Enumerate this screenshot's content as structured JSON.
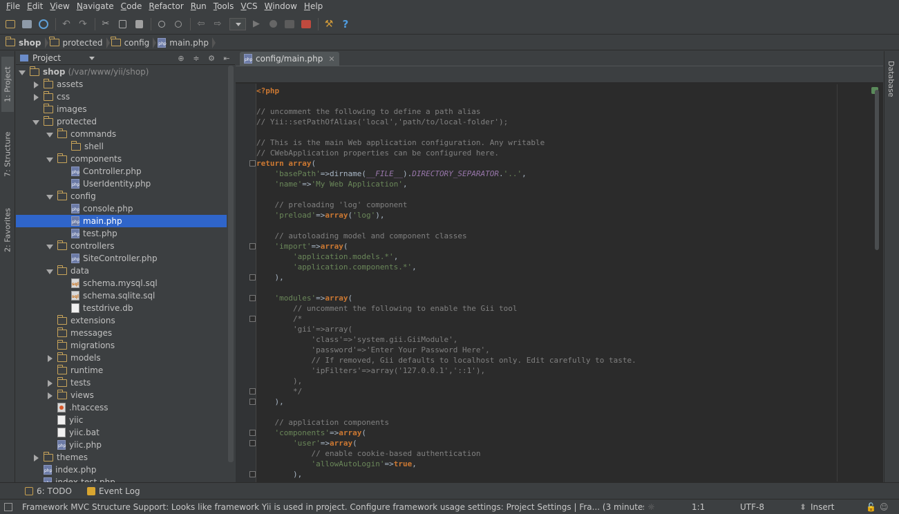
{
  "menu": [
    {
      "label": "File",
      "u": "F",
      "rest": "ile"
    },
    {
      "label": "Edit",
      "u": "E",
      "rest": "dit"
    },
    {
      "label": "View",
      "u": "V",
      "rest": "iew"
    },
    {
      "label": "Navigate",
      "u": "N",
      "rest": "avigate"
    },
    {
      "label": "Code",
      "u": "C",
      "rest": "ode"
    },
    {
      "label": "Refactor",
      "u": "R",
      "rest": "efactor"
    },
    {
      "label": "Run",
      "u": "R",
      "rest": "un"
    },
    {
      "label": "Tools",
      "u": "T",
      "rest": "ools"
    },
    {
      "label": "VCS",
      "u": "V",
      "rest": "CS"
    },
    {
      "label": "Window",
      "u": "W",
      "rest": "indow"
    },
    {
      "label": "Help",
      "u": "H",
      "rest": "elp"
    }
  ],
  "breadcrumb": [
    "shop",
    "protected",
    "config",
    "main.php"
  ],
  "project_panel": {
    "title": "Project",
    "tree": [
      {
        "depth": 0,
        "arrow": "open",
        "icon": "folder",
        "label": "shop",
        "extra": "(/var/www/yii/shop)",
        "bold": true
      },
      {
        "depth": 1,
        "arrow": "closed",
        "icon": "folder",
        "label": "assets"
      },
      {
        "depth": 1,
        "arrow": "closed",
        "icon": "folder",
        "label": "css"
      },
      {
        "depth": 1,
        "arrow": "none",
        "icon": "folder",
        "label": "images"
      },
      {
        "depth": 1,
        "arrow": "open",
        "icon": "folder",
        "label": "protected"
      },
      {
        "depth": 2,
        "arrow": "open",
        "icon": "folder",
        "label": "commands"
      },
      {
        "depth": 3,
        "arrow": "none",
        "icon": "folder",
        "label": "shell"
      },
      {
        "depth": 2,
        "arrow": "open",
        "icon": "folder",
        "label": "components"
      },
      {
        "depth": 3,
        "arrow": "none",
        "icon": "php",
        "label": "Controller.php"
      },
      {
        "depth": 3,
        "arrow": "none",
        "icon": "php",
        "label": "UserIdentity.php"
      },
      {
        "depth": 2,
        "arrow": "open",
        "icon": "folder",
        "label": "config"
      },
      {
        "depth": 3,
        "arrow": "none",
        "icon": "php",
        "label": "console.php"
      },
      {
        "depth": 3,
        "arrow": "none",
        "icon": "php",
        "label": "main.php",
        "selected": true
      },
      {
        "depth": 3,
        "arrow": "none",
        "icon": "php",
        "label": "test.php"
      },
      {
        "depth": 2,
        "arrow": "open",
        "icon": "folder",
        "label": "controllers"
      },
      {
        "depth": 3,
        "arrow": "none",
        "icon": "php",
        "label": "SiteController.php"
      },
      {
        "depth": 2,
        "arrow": "open",
        "icon": "folder",
        "label": "data"
      },
      {
        "depth": 3,
        "arrow": "none",
        "icon": "sql",
        "label": "schema.mysql.sql"
      },
      {
        "depth": 3,
        "arrow": "none",
        "icon": "sql",
        "label": "schema.sqlite.sql"
      },
      {
        "depth": 3,
        "arrow": "none",
        "icon": "txt",
        "label": "testdrive.db"
      },
      {
        "depth": 2,
        "arrow": "none",
        "icon": "folder",
        "label": "extensions"
      },
      {
        "depth": 2,
        "arrow": "none",
        "icon": "folder",
        "label": "messages"
      },
      {
        "depth": 2,
        "arrow": "none",
        "icon": "folder",
        "label": "migrations"
      },
      {
        "depth": 2,
        "arrow": "closed",
        "icon": "folder",
        "label": "models"
      },
      {
        "depth": 2,
        "arrow": "none",
        "icon": "folder",
        "label": "runtime"
      },
      {
        "depth": 2,
        "arrow": "closed",
        "icon": "folder",
        "label": "tests"
      },
      {
        "depth": 2,
        "arrow": "closed",
        "icon": "folder",
        "label": "views"
      },
      {
        "depth": 2,
        "arrow": "none",
        "icon": "ht",
        "label": ".htaccess"
      },
      {
        "depth": 2,
        "arrow": "none",
        "icon": "txt",
        "label": "yiic"
      },
      {
        "depth": 2,
        "arrow": "none",
        "icon": "txt",
        "label": "yiic.bat"
      },
      {
        "depth": 2,
        "arrow": "none",
        "icon": "php",
        "label": "yiic.php"
      },
      {
        "depth": 1,
        "arrow": "closed",
        "icon": "folder",
        "label": "themes"
      },
      {
        "depth": 1,
        "arrow": "none",
        "icon": "php",
        "label": "index.php"
      },
      {
        "depth": 1,
        "arrow": "none",
        "icon": "php",
        "label": "index-test.php"
      }
    ]
  },
  "left_tabs": {
    "project": "1: Project",
    "structure": "7: Structure",
    "favorites": "2: Favorites"
  },
  "right_tabs": {
    "database": "Database"
  },
  "editor": {
    "tab_label": "config/main.php",
    "tab_close": "✕",
    "lines": [
      {
        "i": 0,
        "s": [
          [
            "php",
            "<?php"
          ]
        ]
      },
      {
        "i": 2,
        "s": [
          [
            "com",
            "// uncomment the following to define a path alias"
          ]
        ]
      },
      {
        "i": 3,
        "s": [
          [
            "com",
            "// Yii::setPathOfAlias('local','path/to/local-folder');"
          ]
        ]
      },
      {
        "i": 5,
        "s": [
          [
            "com",
            "// This is the main Web application configuration. Any writable"
          ]
        ]
      },
      {
        "i": 6,
        "s": [
          [
            "com",
            "// CWebApplication properties can be configured here."
          ]
        ]
      },
      {
        "i": 7,
        "s": [
          [
            "kw",
            "return "
          ],
          [
            "kw",
            "array"
          ],
          [
            "t",
            "("
          ]
        ]
      },
      {
        "i": 8,
        "s": [
          [
            "t",
            "    "
          ],
          [
            "str",
            "'basePath'"
          ],
          [
            "t",
            "=>dirname("
          ],
          [
            "const",
            "__FILE__"
          ],
          [
            "t",
            ")."
          ],
          [
            "const",
            "DIRECTORY_SEPARATOR"
          ],
          [
            "t",
            "."
          ],
          [
            "str",
            "'..'"
          ],
          [
            "t",
            ","
          ]
        ]
      },
      {
        "i": 9,
        "s": [
          [
            "t",
            "    "
          ],
          [
            "str",
            "'name'"
          ],
          [
            "t",
            "=>"
          ],
          [
            "str",
            "'My Web Application'"
          ],
          [
            "t",
            ","
          ]
        ]
      },
      {
        "i": 11,
        "s": [
          [
            "t",
            "    "
          ],
          [
            "com",
            "// preloading 'log' component"
          ]
        ]
      },
      {
        "i": 12,
        "s": [
          [
            "t",
            "    "
          ],
          [
            "str",
            "'preload'"
          ],
          [
            "t",
            "=>"
          ],
          [
            "kw",
            "array"
          ],
          [
            "t",
            "("
          ],
          [
            "str",
            "'log'"
          ],
          [
            "t",
            "),"
          ]
        ]
      },
      {
        "i": 14,
        "s": [
          [
            "t",
            "    "
          ],
          [
            "com",
            "// autoloading model and component classes"
          ]
        ]
      },
      {
        "i": 15,
        "s": [
          [
            "t",
            "    "
          ],
          [
            "str",
            "'import'"
          ],
          [
            "t",
            "=>"
          ],
          [
            "kw",
            "array"
          ],
          [
            "t",
            "("
          ]
        ]
      },
      {
        "i": 16,
        "s": [
          [
            "t",
            "        "
          ],
          [
            "str",
            "'application.models.*'"
          ],
          [
            "t",
            ","
          ]
        ]
      },
      {
        "i": 17,
        "s": [
          [
            "t",
            "        "
          ],
          [
            "str",
            "'application.components.*'"
          ],
          [
            "t",
            ","
          ]
        ]
      },
      {
        "i": 18,
        "s": [
          [
            "t",
            "    ),"
          ]
        ]
      },
      {
        "i": 20,
        "s": [
          [
            "t",
            "    "
          ],
          [
            "str",
            "'modules'"
          ],
          [
            "t",
            "=>"
          ],
          [
            "kw",
            "array"
          ],
          [
            "t",
            "("
          ]
        ]
      },
      {
        "i": 21,
        "s": [
          [
            "t",
            "        "
          ],
          [
            "com",
            "// uncomment the following to enable the Gii tool"
          ]
        ]
      },
      {
        "i": 22,
        "s": [
          [
            "t",
            "        "
          ],
          [
            "com",
            "/*"
          ]
        ]
      },
      {
        "i": 23,
        "s": [
          [
            "t",
            "        "
          ],
          [
            "com",
            "'gii'=>array("
          ]
        ]
      },
      {
        "i": 24,
        "s": [
          [
            "t",
            "            "
          ],
          [
            "com",
            "'class'=>'system.gii.GiiModule',"
          ]
        ]
      },
      {
        "i": 25,
        "s": [
          [
            "t",
            "            "
          ],
          [
            "com",
            "'password'=>'Enter Your Password Here',"
          ]
        ]
      },
      {
        "i": 26,
        "s": [
          [
            "t",
            "            "
          ],
          [
            "com",
            "// If removed, Gii defaults to localhost only. Edit carefully to taste."
          ]
        ]
      },
      {
        "i": 27,
        "s": [
          [
            "t",
            "            "
          ],
          [
            "com",
            "'ipFilters'=>array('127.0.0.1','::1'),"
          ]
        ]
      },
      {
        "i": 28,
        "s": [
          [
            "t",
            "        "
          ],
          [
            "com",
            "),"
          ]
        ]
      },
      {
        "i": 29,
        "s": [
          [
            "t",
            "        "
          ],
          [
            "com",
            "*/"
          ]
        ]
      },
      {
        "i": 30,
        "s": [
          [
            "t",
            "    ),"
          ]
        ]
      },
      {
        "i": 32,
        "s": [
          [
            "t",
            "    "
          ],
          [
            "com",
            "// application components"
          ]
        ]
      },
      {
        "i": 33,
        "s": [
          [
            "t",
            "    "
          ],
          [
            "str",
            "'components'"
          ],
          [
            "t",
            "=>"
          ],
          [
            "kw",
            "array"
          ],
          [
            "t",
            "("
          ]
        ]
      },
      {
        "i": 34,
        "s": [
          [
            "t",
            "        "
          ],
          [
            "str",
            "'user'"
          ],
          [
            "t",
            "=>"
          ],
          [
            "kw",
            "array"
          ],
          [
            "t",
            "("
          ]
        ]
      },
      {
        "i": 35,
        "s": [
          [
            "t",
            "            "
          ],
          [
            "com",
            "// enable cookie-based authentication"
          ]
        ]
      },
      {
        "i": 36,
        "s": [
          [
            "t",
            "            "
          ],
          [
            "str",
            "'allowAutoLogin'"
          ],
          [
            "t",
            "=>"
          ],
          [
            "kw",
            "true"
          ],
          [
            "t",
            ","
          ]
        ]
      },
      {
        "i": 37,
        "s": [
          [
            "t",
            "        ),"
          ]
        ]
      },
      {
        "i": 38,
        "s": [
          [
            "t",
            "        "
          ],
          [
            "com",
            "// uncomment the following to enable URLs in path-format"
          ]
        ]
      }
    ]
  },
  "bottom_tools": {
    "todo": "6: TODO",
    "event_log": "Event Log"
  },
  "status": {
    "message": "Framework MVC Structure Support: Looks like framework Yii is used in project. Configure framework usage settings: Project Settings | Fra... (3 minutes ago)",
    "position": "1:1",
    "encoding": "UTF-8",
    "mode": "Insert"
  },
  "colors": {
    "selection": "#2f65ca",
    "keyword": "#cc7832",
    "string": "#6a8759",
    "comment": "#808080"
  }
}
